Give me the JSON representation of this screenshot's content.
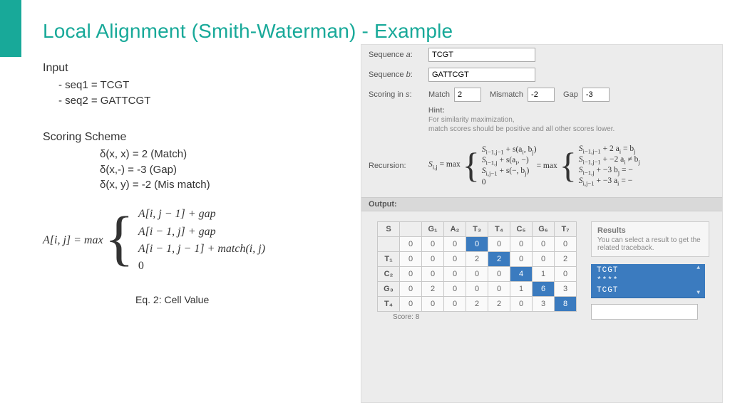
{
  "title": "Local Alignment (Smith-Waterman) - Example",
  "left": {
    "input_head": "Input",
    "seq1_line": "- seq1 =  TCGT",
    "seq2_line": "- seq2 = GATTCGT",
    "scoring_head": "Scoring Scheme",
    "match_line": "δ(x, x) = 2 (Match)",
    "gap_line": "δ(x,-) = -3 (Gap)",
    "mismatch_line": "δ(x, y) = -2 (Mis match)",
    "eq_lhs": "A[i, j] = max",
    "eq_case1": "A[i, j − 1] + gap",
    "eq_case2": "A[i − 1, j] + gap",
    "eq_case3": "A[i − 1, j − 1] + match(i, j)",
    "eq_case4": "0",
    "caption": "Eq. 2: Cell Value"
  },
  "panel": {
    "labels": {
      "seq_a": "Sequence a:",
      "seq_b": "Sequence b:",
      "scoring": "Scoring in s:",
      "match": "Match",
      "mismatch": "Mismatch",
      "gap": "Gap",
      "recursion": "Recursion:",
      "output": "Output:",
      "results_title": "Results",
      "results_desc": "You can select a result to get the related traceback.",
      "score_label": "Score:"
    },
    "values": {
      "seq_a": "TCGT",
      "seq_b": "GATTCGT",
      "match": "2",
      "mismatch": "-2",
      "gap": "-3",
      "score": "8"
    },
    "hint": {
      "title": "Hint:",
      "line1": "For similarity maximization,",
      "line2": "match scores should be positive and all other scores lower."
    },
    "recursion_math": {
      "lhs": "S",
      "sub_lhs": "i,j",
      "eq": " = max",
      "c1a": "S",
      "c1a_sub": "i−1,j−1",
      "c1b": " +  s(a",
      "c1b_sub": "i",
      "c1c": ", b",
      "c1c_sub": "j",
      "c1d": ")",
      "c2a": "S",
      "c2a_sub": "i−1,j",
      "c2b": " +  s(a",
      "c2b_sub": "i",
      "c2c": ", −)",
      "c3a": "S",
      "c3a_sub": "i,j−1",
      "c3b": " +  s(−, b",
      "c3b_sub": "j",
      "c3c": ")",
      "c4": "0",
      "eq2": " = max",
      "d1a": "S",
      "d1a_sub": "i−1,j−1",
      "d1b": " +   2  a",
      "d1b_sub": "i",
      "d1c": " = b",
      "d1c_sub": "j",
      "d2a": "S",
      "d2a_sub": "i−1,j−1",
      "d2b": " +  −2  a",
      "d2b_sub": "i",
      "d2c": " ≠ b",
      "d2c_sub": "j",
      "d3a": "S",
      "d3a_sub": "i−1,j",
      "d3b": " +  −3  b",
      "d3b_sub": "j",
      "d3c": " = −",
      "d4a": "S",
      "d4a_sub": "i,j−1",
      "d4b": " +  −3  a",
      "d4b_sub": "i",
      "d4c": " = −"
    },
    "table": {
      "corner": "S",
      "cols": [
        "",
        "G₁",
        "A₂",
        "T₃",
        "T₄",
        "C₅",
        "G₆",
        "T₇"
      ],
      "rows": [
        {
          "h": "",
          "cells": [
            "0",
            "0",
            "0",
            "0",
            "0",
            "0",
            "0",
            "0"
          ]
        },
        {
          "h": "T₁",
          "cells": [
            "0",
            "0",
            "0",
            "2",
            "2",
            "0",
            "0",
            "2"
          ]
        },
        {
          "h": "C₂",
          "cells": [
            "0",
            "0",
            "0",
            "0",
            "0",
            "4",
            "1",
            "0"
          ]
        },
        {
          "h": "G₃",
          "cells": [
            "0",
            "2",
            "0",
            "0",
            "0",
            "1",
            "6",
            "3"
          ]
        },
        {
          "h": "T₄",
          "cells": [
            "0",
            "0",
            "0",
            "2",
            "2",
            "0",
            "3",
            "8"
          ]
        }
      ],
      "highlights": [
        [
          0,
          3
        ],
        [
          1,
          4
        ],
        [
          2,
          5
        ],
        [
          3,
          6
        ],
        [
          4,
          7
        ]
      ]
    },
    "results": {
      "line1": "TCGT",
      "line2": "****",
      "line3": "TCGT"
    }
  }
}
